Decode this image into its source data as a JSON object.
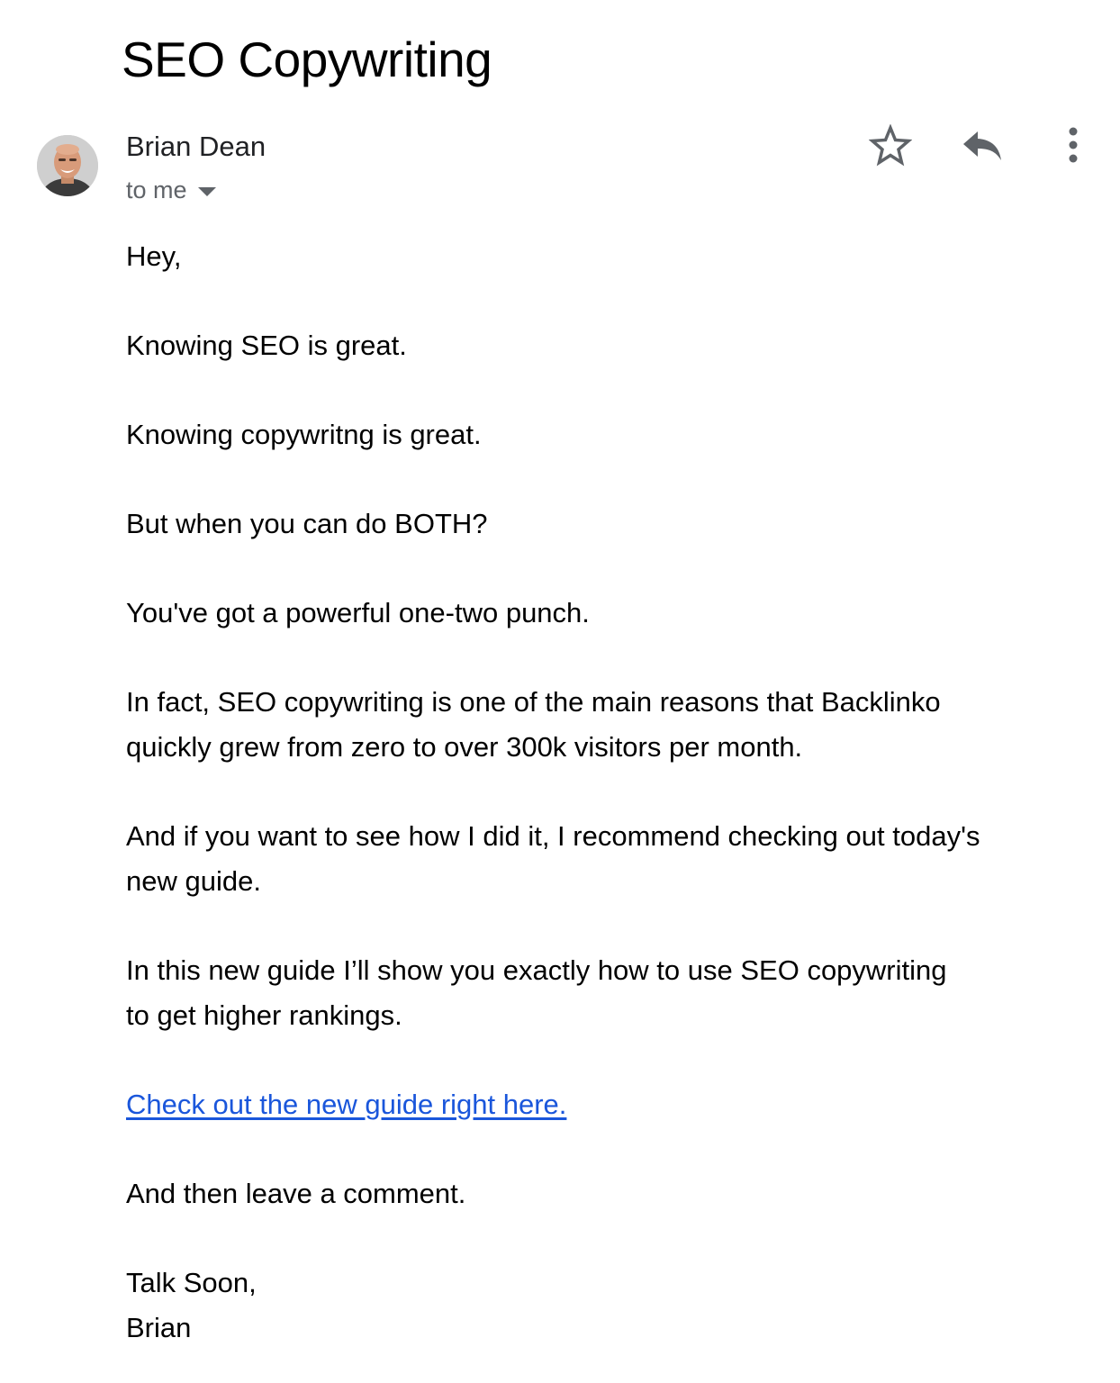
{
  "email": {
    "subject": "SEO Copywriting",
    "sender": {
      "name": "Brian Dean",
      "avatar_icon": "avatar-photo"
    },
    "recipient_label": "to me",
    "actions": {
      "star_icon": "star-icon",
      "reply_icon": "reply-icon",
      "more_icon": "more-vertical-icon"
    },
    "body": {
      "greeting": "Hey,",
      "p1": "Knowing SEO is great.",
      "p2": "Knowing copywritng is great.",
      "p3": "But when you can do BOTH?",
      "p4": "You've got a powerful one-two punch.",
      "p5_line1": "In fact, SEO copywriting is one of the main reasons that Backlinko",
      "p5_line2": "quickly grew from zero to over 300k visitors per month.",
      "p6_line1": "And if you want to see how I did it, I recommend checking out today's",
      "p6_line2": "new guide.",
      "p7_line1": "In this new guide I’ll show you exactly how to use SEO copywriting",
      "p7_line2": "to get higher rankings.",
      "link_text": "Check out the new guide right here.",
      "p8": "And then leave a comment.",
      "signoff": "Talk Soon,",
      "signature": "Brian"
    }
  },
  "colors": {
    "link": "#1a56db",
    "muted": "#5f6368",
    "text": "#000000"
  }
}
